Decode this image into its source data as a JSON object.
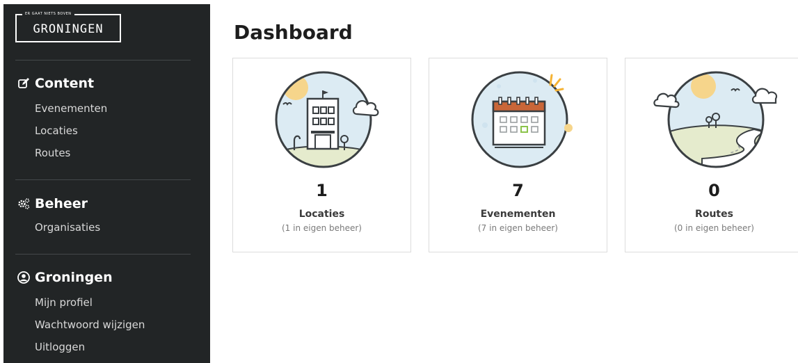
{
  "logo": {
    "tagline": "ER GAAT NIETS BOVEN",
    "name": "GRONINGEN"
  },
  "sidebar": {
    "sections": [
      {
        "title": "Content",
        "icon": "edit-icon",
        "items": [
          "Evenementen",
          "Locaties",
          "Routes"
        ]
      },
      {
        "title": "Beheer",
        "icon": "gears-icon",
        "items": [
          "Organisaties"
        ]
      },
      {
        "title": "Groningen",
        "icon": "user-circle-icon",
        "items": [
          "Mijn profiel",
          "Wachtwoord wijzigen",
          "Uitloggen"
        ]
      }
    ]
  },
  "main": {
    "title": "Dashboard",
    "cards": [
      {
        "count": "1",
        "label": "Locaties",
        "sub": "(1 in eigen beheer)",
        "illustration": "building-illustration"
      },
      {
        "count": "7",
        "label": "Evenementen",
        "sub": "(7 in eigen beheer)",
        "illustration": "calendar-illustration"
      },
      {
        "count": "0",
        "label": "Routes",
        "sub": "(0 in eigen beheer)",
        "illustration": "road-illustration"
      }
    ]
  },
  "colors": {
    "sidebar_bg": "#222526",
    "sky": "#dcebf3",
    "grass": "#e5ebcd",
    "sun": "#f6d58b",
    "calendar_red": "#c96638",
    "accent_green": "#8bc34a",
    "outline": "#3a3f42"
  }
}
